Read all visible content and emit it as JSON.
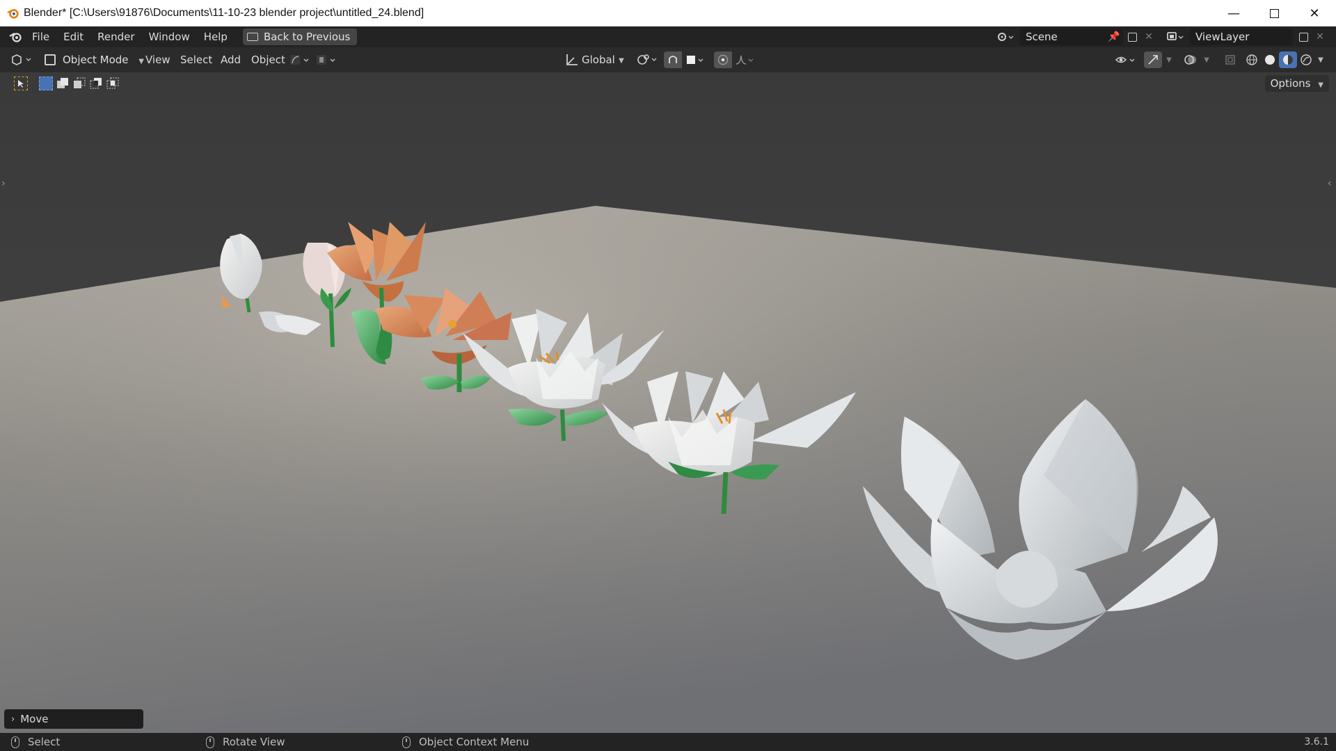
{
  "window": {
    "title": "Blender* [C:\\Users\\91876\\Documents\\11-10-23 blender project\\untitled_24.blend]",
    "minimize_icon": "minimize-icon",
    "maximize_icon": "maximize-icon",
    "close_icon": "close-icon"
  },
  "menubar": {
    "items": [
      "File",
      "Edit",
      "Render",
      "Window",
      "Help"
    ],
    "back_button": "Back to Previous",
    "scene_label": "Scene",
    "view_layer_label": "ViewLayer"
  },
  "viewport_header": {
    "mode": "Object Mode",
    "menus": [
      "View",
      "Select",
      "Add",
      "Object"
    ],
    "transform_orientation": "Global",
    "options_label": "Options"
  },
  "operator_panel": {
    "label": "Move"
  },
  "statusbar": {
    "items": [
      "Select",
      "Rotate View",
      "Object Context Menu"
    ],
    "version": "3.6.1"
  },
  "colors": {
    "titlebar_bg": "#ffffff",
    "menubar_bg": "#232323",
    "header_bg": "#2b2b2b",
    "viewport_bg": "#3d3d3d",
    "active_shading": "#4772b3",
    "petal_white": "#e9ecef",
    "petal_orange": "#d9895a",
    "stem_green": "#2e8b3e"
  }
}
